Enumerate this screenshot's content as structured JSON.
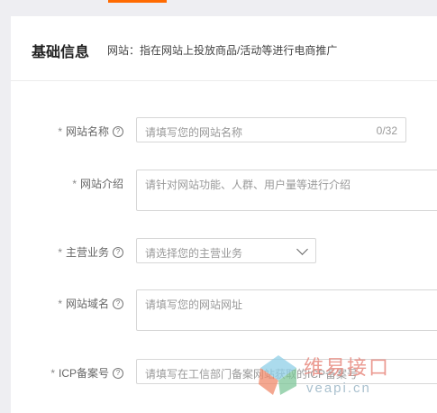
{
  "section": {
    "title": "基础信息",
    "description": "网站：指在网站上投放商品/活动等进行电商推广"
  },
  "form": {
    "required_mark": "*",
    "help_glyph": "?",
    "site_name": {
      "label": "网站名称",
      "placeholder": "请填写您的网站名称",
      "counter": "0/32"
    },
    "site_intro": {
      "label": "网站介绍",
      "placeholder": "请针对网站功能、人群、用户量等进行介绍"
    },
    "main_business": {
      "label": "主营业务",
      "placeholder": "请选择您的主营业务"
    },
    "site_domain": {
      "label": "网站域名",
      "placeholder": "请填写您的网站网址"
    },
    "icp": {
      "label": "ICP备案号",
      "placeholder": "请填写在工信部门备案网站获取的ICP备案号"
    }
  },
  "watermark": {
    "text": "维易接口",
    "sub": "veapi.cn",
    "logo_colors": [
      "#f08a6b",
      "#8fcfe7",
      "#7fc79a"
    ]
  },
  "colors": {
    "accent": "#ff6a00",
    "border": "#d7d7d7",
    "background": "#eeeef2"
  }
}
